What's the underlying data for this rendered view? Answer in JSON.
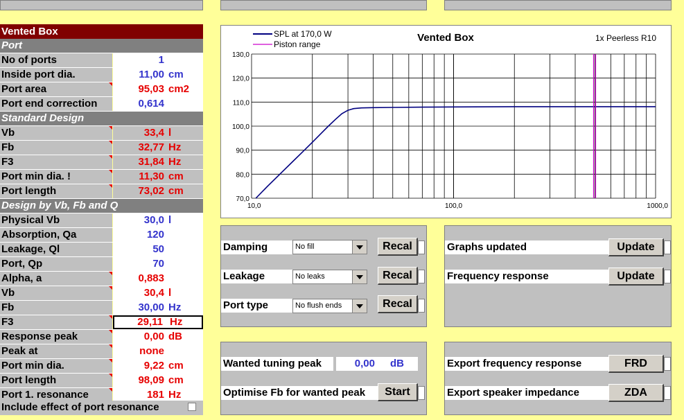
{
  "left": {
    "title": "Vented Box",
    "sections": {
      "port": "Port",
      "standard": "Standard Design",
      "design": "Design by Vb, Fb and Q"
    },
    "rows": [
      {
        "label": "No of ports",
        "value": "1",
        "unit": "",
        "color": "blue"
      },
      {
        "label": "Inside port dia.",
        "value": "11,00",
        "unit": "cm",
        "color": "blue"
      },
      {
        "label": "Port area",
        "value": "95,03",
        "unit": "cm2",
        "color": "red"
      },
      {
        "label": "Port end correction",
        "value": "0,614",
        "unit": "",
        "color": "blue"
      },
      {
        "label": "Vb",
        "value": "33,4",
        "unit": "l",
        "color": "red"
      },
      {
        "label": "Fb",
        "value": "32,77",
        "unit": "Hz",
        "color": "red"
      },
      {
        "label": "F3",
        "value": "31,84",
        "unit": "Hz",
        "color": "red"
      },
      {
        "label": "Port min dia. !",
        "value": "11,30",
        "unit": "cm",
        "color": "red"
      },
      {
        "label": "Port length",
        "value": "73,02",
        "unit": "cm",
        "color": "red"
      },
      {
        "label": "Physical Vb",
        "value": "30,0",
        "unit": "l",
        "color": "blue"
      },
      {
        "label": "Absorption, Qa",
        "value": "120",
        "unit": "",
        "color": "blue"
      },
      {
        "label": "Leakage, Ql",
        "value": "50",
        "unit": "",
        "color": "blue"
      },
      {
        "label": "Port, Qp",
        "value": "70",
        "unit": "",
        "color": "blue"
      },
      {
        "label": "Alpha, a",
        "value": "0,883",
        "unit": "",
        "color": "red"
      },
      {
        "label": "Vb",
        "value": "30,4",
        "unit": "l",
        "color": "red"
      },
      {
        "label": "Fb",
        "value": "30,00",
        "unit": "Hz",
        "color": "blue"
      },
      {
        "label": "F3",
        "value": "29,11",
        "unit": "Hz",
        "color": "red"
      },
      {
        "label": "Response peak",
        "value": "0,00",
        "unit": "dB",
        "color": "red"
      },
      {
        "label": "Peak at",
        "value": "none",
        "unit": "",
        "color": "red"
      },
      {
        "label": "Port min dia.",
        "value": "9,22",
        "unit": "cm",
        "color": "red"
      },
      {
        "label": "Port length",
        "value": "98,09",
        "unit": "cm",
        "color": "red"
      },
      {
        "label": "Port 1. resonance",
        "value": "181",
        "unit": "Hz",
        "color": "red"
      }
    ],
    "include_label": "Include effect of port resonance"
  },
  "controls": {
    "damping": {
      "label": "Damping",
      "value": "No fill",
      "button": "Recal"
    },
    "leakage": {
      "label": "Leakage",
      "value": "No leaks",
      "button": "Recal"
    },
    "porttype": {
      "label": "Port type",
      "value": "No flush ends",
      "button": "Recal"
    },
    "graphs": {
      "label": "Graphs updated",
      "button": "Update"
    },
    "freq": {
      "label": "Frequency response",
      "button": "Update"
    },
    "wanted": {
      "label": "Wanted tuning peak",
      "value": "0,00",
      "unit": "dB"
    },
    "optimise": {
      "label": "Optimise Fb for wanted peak",
      "button": "Start"
    },
    "export_freq": {
      "label": "Export frequency response",
      "button": "FRD"
    },
    "export_imp": {
      "label": "Export speaker impedance",
      "button": "ZDA"
    }
  },
  "chart_data": {
    "type": "line",
    "title": "Vented Box",
    "subtitle": "1x Peerless R10",
    "x_scale": "log",
    "xlim": [
      10,
      1000
    ],
    "ylim": [
      70,
      130
    ],
    "x_ticks": [
      "10,0",
      "100,0",
      "1000,0"
    ],
    "y_ticks": [
      "70,0",
      "80,0",
      "90,0",
      "100,0",
      "110,0",
      "120,0",
      "130,0"
    ],
    "legend": "top-left",
    "grid": true,
    "series": [
      {
        "name": "SPL at 170,0 W",
        "color": "#000080",
        "x": [
          10.5,
          12,
          14,
          16,
          18,
          20,
          22,
          24,
          26,
          28,
          30,
          32,
          35,
          40,
          50,
          70,
          100,
          200,
          500,
          1000
        ],
        "y": [
          70.0,
          75.0,
          80.5,
          85.3,
          89.5,
          93.3,
          96.8,
          100.0,
          102.8,
          105.2,
          106.6,
          107.3,
          107.6,
          107.7,
          107.8,
          107.9,
          108.0,
          108.1,
          108.1,
          108.1
        ]
      },
      {
        "name": "Piston range",
        "color": "#CC00CC",
        "x": [
          505,
          505
        ],
        "y": [
          70,
          130
        ]
      }
    ]
  }
}
